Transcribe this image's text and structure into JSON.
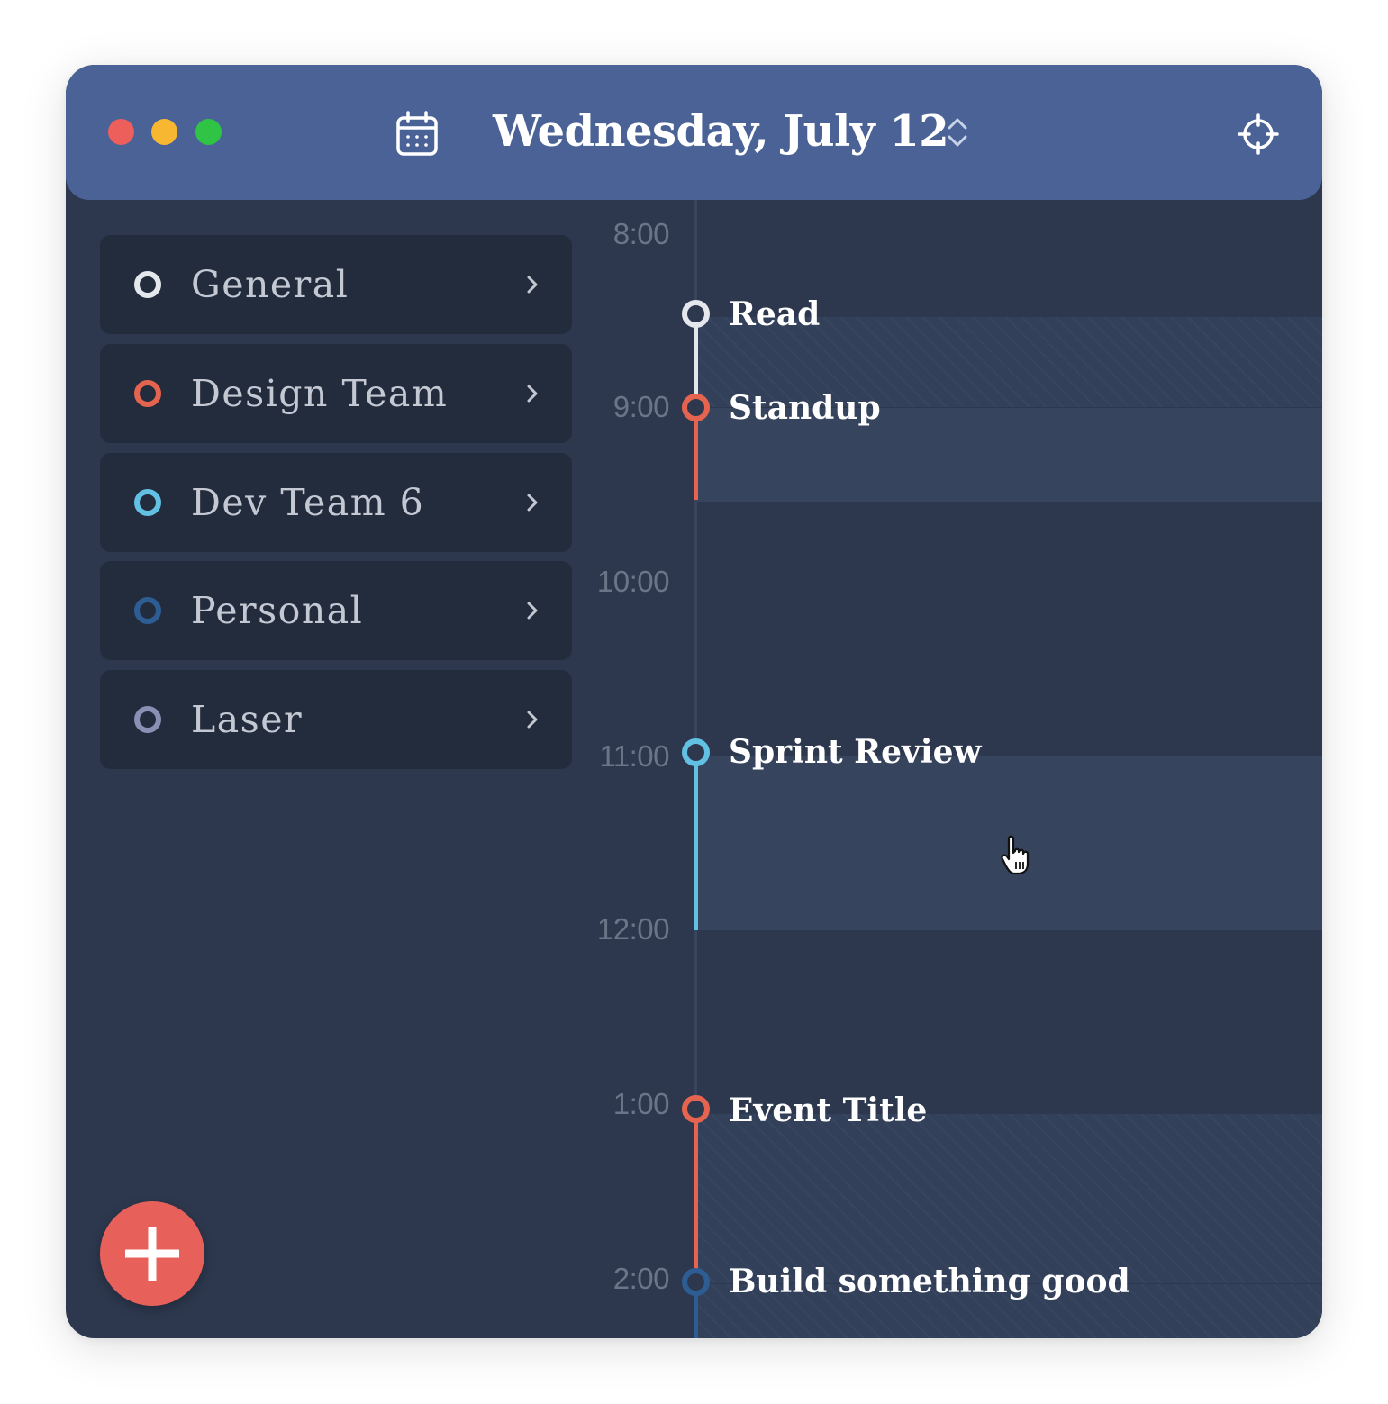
{
  "header": {
    "date_title": "Wednesday, July 12",
    "icons": {
      "calendar": "calendar-icon",
      "stepper": "chevron-up-down-icon",
      "locate": "crosshair-icon"
    },
    "traffic_lights": {
      "close": "#ec5f5a",
      "minimize": "#f7b731",
      "zoom": "#2fc445"
    },
    "accent": "#4a6296"
  },
  "sidebar": {
    "categories": [
      {
        "label": "General",
        "color": "#e4e7ec"
      },
      {
        "label": "Design Team",
        "color": "#e5644f"
      },
      {
        "label": "Dev Team 6",
        "color": "#62c0e3"
      },
      {
        "label": "Personal",
        "color": "#2e5d93"
      },
      {
        "label": "Laser",
        "color": "#8a8fb4"
      }
    ],
    "add_button_icon": "plus-icon",
    "add_button_color": "#e8605a"
  },
  "timeline": {
    "hours": [
      "8:00",
      "9:00",
      "10:00",
      "11:00",
      "12:00",
      "1:00",
      "2:00"
    ],
    "events": [
      {
        "title": "Read",
        "start": "8:30",
        "end": "9:00",
        "color": "#e4e7ec",
        "pattern": "hatched"
      },
      {
        "title": "Standup",
        "start": "9:00",
        "end": "9:30",
        "color": "#e5644f",
        "pattern": "solid"
      },
      {
        "title": "Sprint Review",
        "start": "11:00",
        "end": "12:00",
        "color": "#62c0e3",
        "pattern": "solid"
      },
      {
        "title": "Event Title",
        "start": "1:00",
        "end": "2:00",
        "color": "#e5644f",
        "pattern": "hatched"
      },
      {
        "title": "Build something good",
        "start": "2:00",
        "color": "#2e5d93",
        "pattern": "hatched"
      }
    ]
  }
}
